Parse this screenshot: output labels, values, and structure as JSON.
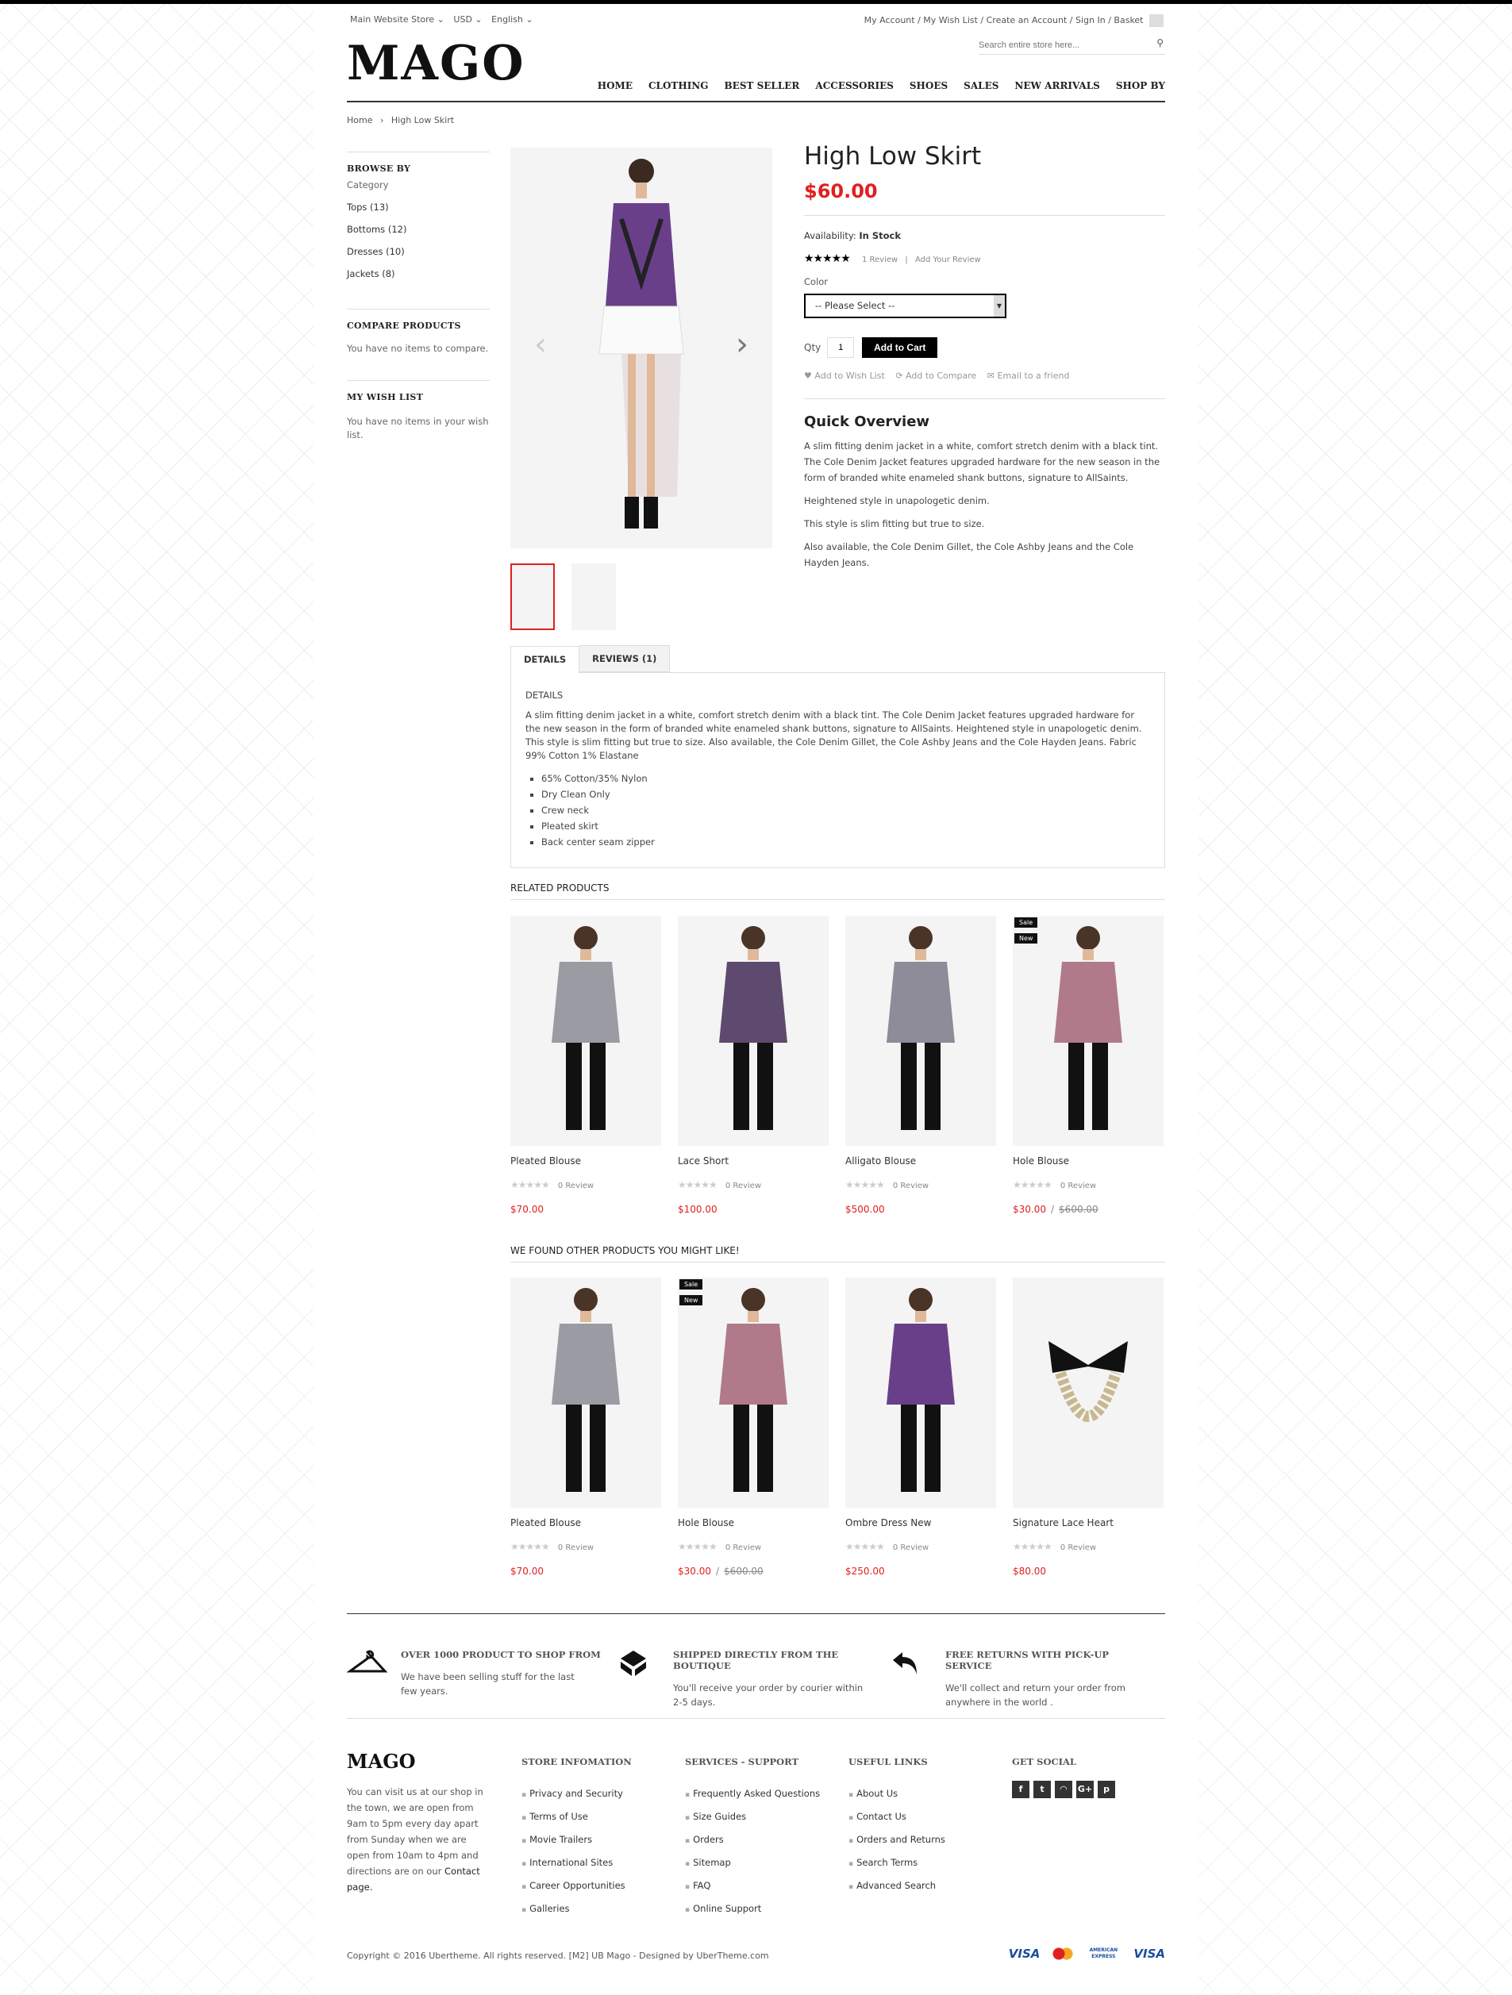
{
  "top": {
    "store": "Main Website Store",
    "currency": "USD",
    "language": "English",
    "links": [
      "My Account",
      "My Wish List",
      "Create an Account",
      "Sign In",
      "Basket"
    ],
    "search_placeholder": "Search entire store here..."
  },
  "logo": "MAGO",
  "nav": [
    "HOME",
    "CLOTHING",
    "BEST SELLER",
    "ACCESSORIES",
    "SHOES",
    "SALES",
    "NEW ARRIVALS",
    "SHOP BY"
  ],
  "breadcrumb": {
    "home": "Home",
    "current": "High Low Skirt"
  },
  "sidebar": {
    "browse_title": "BROWSE BY",
    "category_label": "Category",
    "categories": [
      "Tops (13)",
      "Bottoms (12)",
      "Dresses (10)",
      "Jackets (8)"
    ],
    "compare_title": "COMPARE PRODUCTS",
    "compare_text": "You have no items to compare.",
    "wish_title": "MY WISH LIST",
    "wish_text": "You have no items in your wish list."
  },
  "product": {
    "title": "High Low Skirt",
    "price": "$60.00",
    "availability_label": "Availability:",
    "availability": "In Stock",
    "rating": 5,
    "reviews_link": "1 Review",
    "add_review": "Add Your Review",
    "color_label": "Color",
    "color_select": "-- Please Select --",
    "qty_label": "Qty",
    "qty": "1",
    "add_to_cart": "Add to Cart",
    "wishlist": "Add to Wish List",
    "compare": "Add to Compare",
    "email": "Email to a friend",
    "overview_title": "Quick Overview",
    "overview": [
      "A slim fitting denim jacket in a white, comfort stretch denim with a black tint. The Cole Denim Jacket features upgraded hardware for the new season in the form of branded white enameled shank buttons, signature to AllSaints.",
      "Heightened style in unapologetic denim.",
      "This style is slim fitting but true to size.",
      "Also available, the Cole Denim Gillet, the Cole Ashby Jeans and the Cole Hayden Jeans."
    ]
  },
  "tabs": {
    "details": "DETAILS",
    "reviews": "REVIEWS  (1)",
    "details_heading": "DETAILS",
    "details_text": "A slim fitting denim jacket in a white, comfort stretch denim with a black tint. The Cole Denim Jacket features upgraded hardware for the new season in the form of branded white enameled shank buttons, signature to AllSaints. Heightened style in unapologetic denim. This style is slim fitting but true to size. Also available, the Cole Denim Gillet, the Cole Ashby Jeans and the Cole Hayden Jeans. Fabric 99% Cotton 1% Elastane",
    "bullets": [
      "65% Cotton/35% Nylon",
      "Dry Clean Only",
      "Crew neck",
      "Pleated skirt",
      "Back center seam zipper"
    ]
  },
  "related": {
    "title": "RELATED PRODUCTS",
    "items": [
      {
        "name": "Pleated Blouse",
        "review": "0 Review",
        "price": "$70.00",
        "old_price": "",
        "badges": [],
        "color": "#9a9ba3"
      },
      {
        "name": "Lace Short",
        "review": "0 Review",
        "price": "$100.00",
        "old_price": "",
        "badges": [],
        "color": "#5e4a6e"
      },
      {
        "name": "Alligato Blouse",
        "review": "0 Review",
        "price": "$500.00",
        "old_price": "",
        "badges": [],
        "color": "#8d8c98"
      },
      {
        "name": "Hole Blouse",
        "review": "0 Review",
        "price": "$30.00",
        "old_price": "$600.00",
        "badges": [
          "Sale",
          "New"
        ],
        "color": "#b07a8a"
      }
    ]
  },
  "also": {
    "title": "WE FOUND OTHER PRODUCTS YOU MIGHT LIKE!",
    "items": [
      {
        "name": "Pleated Blouse",
        "review": "0 Review",
        "price": "$70.00",
        "old_price": "",
        "badges": [],
        "color": "#9a9ba3"
      },
      {
        "name": "Hole Blouse",
        "review": "0 Review",
        "price": "$30.00",
        "old_price": "$600.00",
        "badges": [
          "Sale",
          "New"
        ],
        "color": "#b07a8a"
      },
      {
        "name": "Ombre Dress New",
        "review": "0 Review",
        "price": "$250.00",
        "old_price": "",
        "badges": [],
        "color": "#6a3f8a"
      },
      {
        "name": "Signature Lace Heart",
        "review": "0 Review",
        "price": "$80.00",
        "old_price": "",
        "badges": [],
        "color": "necklace"
      }
    ]
  },
  "features": [
    {
      "title": "OVER 1000 PRODUCT TO SHOP FROM",
      "text": "We have been selling stuff for the last few years.",
      "icon": "hanger-icon"
    },
    {
      "title": "SHIPPED DIRECTLY FROM THE BOUTIQUE",
      "text": "You'll receive your order by courier within 2-5 days.",
      "icon": "box-icon"
    },
    {
      "title": "FREE RETURNS WITH PICK-UP SERVICE",
      "text": "We'll collect and return your order from anywhere in the world .",
      "icon": "return-arrow-icon"
    }
  ],
  "footer": {
    "logo": "MAGO",
    "about": "You can visit us at our shop in the town, we are open from 9am to 5pm every day apart from Sunday when we are open from 10am to 4pm and directions are on our",
    "contact_link": "Contact page.",
    "cols": [
      {
        "title": "STORE INFOMATION",
        "links": [
          "Privacy and Security",
          "Terms of Use",
          "Movie Trailers",
          "International Sites",
          "Career Opportunities",
          "Galleries"
        ]
      },
      {
        "title": "SERVICES - SUPPORT",
        "links": [
          "Frequently Asked Questions",
          "Size Guides",
          "Orders",
          "Sitemap",
          "FAQ",
          "Online Support"
        ]
      },
      {
        "title": "USEFUL LINKS",
        "links": [
          "About Us",
          "Contact Us",
          "Orders and Returns",
          "Search Terms",
          "Advanced Search"
        ]
      }
    ],
    "social_title": "GET SOCIAL",
    "social": [
      "f",
      "t",
      "rss",
      "G+",
      "p"
    ],
    "copyright": "Copyright © 2016 Ubertheme. All rights reserved. [M2] UB Mago - Designed by UberTheme.com",
    "payments": [
      "VISA",
      "MasterCard",
      "AMERICAN EXPRESS",
      "VISA"
    ]
  },
  "colors": {
    "accent": "#e02020",
    "dark": "#000000"
  }
}
